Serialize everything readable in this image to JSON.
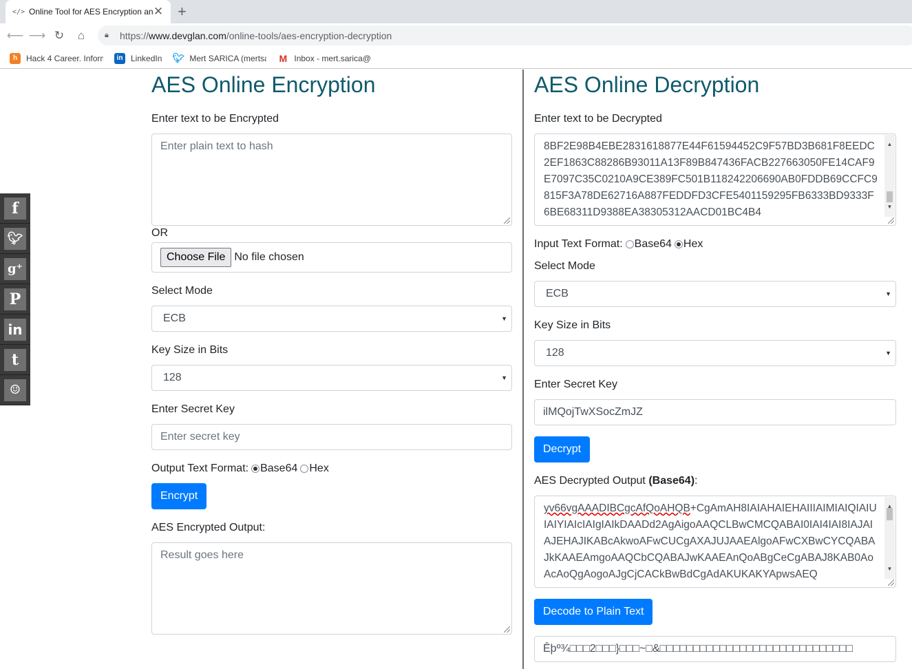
{
  "browser": {
    "tab_title": "Online Tool for AES Encryption an",
    "tab_favicon": "</>",
    "tab_close": "✕",
    "new_tab": "+",
    "url_prefix": "https://",
    "url_host": "www.devglan.com",
    "url_path": "/online-tools/aes-encryption-decryption",
    "bookmarks": [
      {
        "label": "Hack 4 Career. Inform",
        "icon": "hack4career-icon"
      },
      {
        "label": "LinkedIn",
        "icon": "linkedin-icon"
      },
      {
        "label": "Mert SARICA (mertsa",
        "icon": "twitter-icon"
      },
      {
        "label": "Inbox - mert.sarica@",
        "icon": "gmail-icon"
      }
    ]
  },
  "social": [
    "facebook-icon",
    "twitter-icon",
    "google-plus-icon",
    "pinterest-icon",
    "linkedin-icon",
    "tumblr-icon",
    "reddit-icon"
  ],
  "encryption": {
    "title": "AES Online Encryption",
    "input_label": "Enter text to be Encrypted",
    "input_placeholder": "Enter plain text to hash",
    "or_label": "OR",
    "file_button": "Choose File",
    "file_status": "No file chosen",
    "mode_label": "Select Mode",
    "mode_value": "ECB",
    "keysize_label": "Key Size in Bits",
    "keysize_value": "128",
    "key_label": "Enter Secret Key",
    "key_placeholder": "Enter secret key",
    "format_label": "Output Text Format:",
    "format_options": [
      "Base64",
      "Hex"
    ],
    "format_selected": "Base64",
    "encrypt_button": "Encrypt",
    "output_label": "AES Encrypted Output:",
    "output_placeholder": "Result goes here"
  },
  "decryption": {
    "title": "AES Online Decryption",
    "input_label": "Enter text to be Decrypted",
    "input_value": "8BF2E98B4EBE2831618877E44F61594452C9F57BD3B681F8EEDC2EF1863C88286B93011A13F89B847436FACB227663050FE14CAF9E7097C35C0210A9CE389FC501B118242206690AB0FDDB69CCFC9815F3A78DE62716A887FEDDFD3CFE5401159295FB6333BD9333F6BE68311D9388EA38305312AACD01BC4B4",
    "format_label": "Input Text Format:",
    "format_options": [
      "Base64",
      "Hex"
    ],
    "format_selected": "Hex",
    "mode_label": "Select Mode",
    "mode_value": "ECB",
    "keysize_label": "Key Size in Bits",
    "keysize_value": "128",
    "key_label": "Enter Secret Key",
    "key_value": "ilMQojTwXSocZmJZ",
    "decrypt_button": "Decrypt",
    "output_label_prefix": "AES Decrypted Output ",
    "output_label_bold": "(Base64)",
    "output_label_suffix": ":",
    "output_value_underlined": "yv66vgAAADIBCgcAfQoAHQB",
    "output_value": "+CgAmAH8IAIAHAIEHAIIIAIMIAIQIAIUIAIYIAIcIAIgIAIkDAADd2AgAigoAAQCLBwCMCQABAI0IAI4IAI8IAJAIAJEHAJIKABcAkwoAFwCUCgAXAJUJAAEAlgoAFwCXBwCYCQABAJkKAAEAmgoAAQCbCQABAJwKAAEAnQoABgCeCgABAJ8KAB0AoAcAoQgAogoAJgCjCACkBwBdCgAdAKUKAKYApwsAEQ",
    "decode_button": "Decode to Plain Text",
    "plain_value": "Êþº¾□□□2□□□}□□□~□&□□□□□□□□□□□□□□□□□□□□□□□□□□□□□"
  }
}
